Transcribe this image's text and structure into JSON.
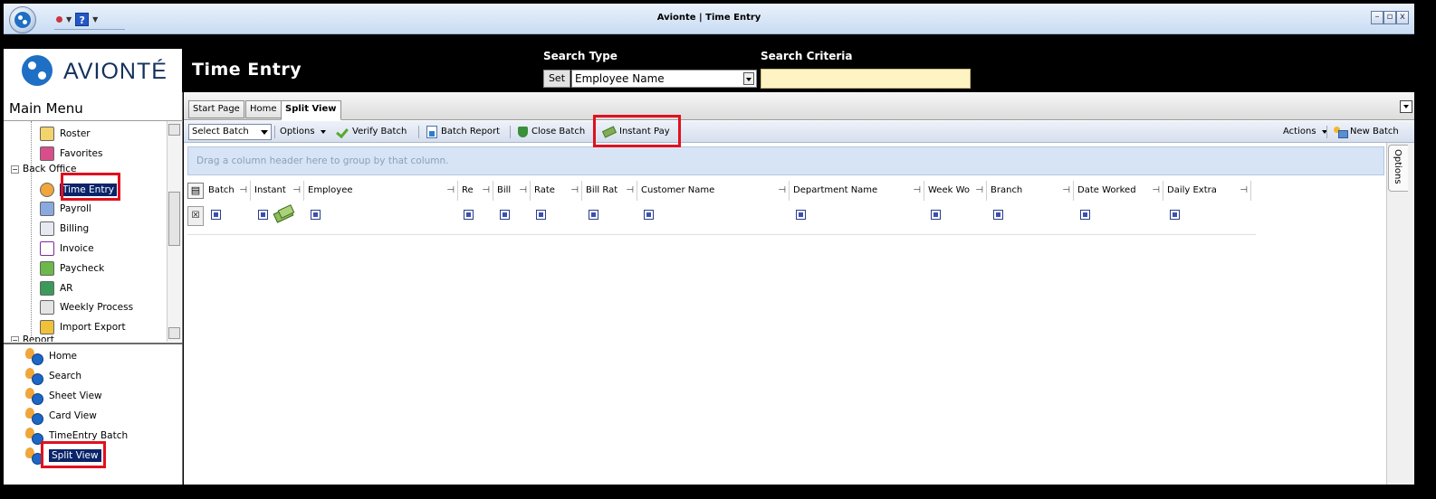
{
  "window": {
    "title": "Avionte | Time Entry"
  },
  "header": {
    "logo_text": "AVIONTÉ",
    "page_title": "Time Entry",
    "search_type_label": "Search Type",
    "search_criteria_label": "Search Criteria",
    "set_label": "Set",
    "search_type_value": "Employee Name",
    "search_criteria_value": ""
  },
  "left": {
    "main_menu_title": "Main Menu",
    "tree": {
      "roster": "Roster",
      "favorites": "Favorites",
      "back_office": "Back Office",
      "time_entry": "Time Entry",
      "payroll": "Payroll",
      "billing": "Billing",
      "invoice": "Invoice",
      "paycheck": "Paycheck",
      "ar": "AR",
      "weekly_process": "Weekly Process",
      "import_export": "Import Export",
      "report": "Report"
    },
    "nav": {
      "home": "Home",
      "search": "Search",
      "sheet_view": "Sheet View",
      "card_view": "Card View",
      "timeentry_batch": "TimeEntry Batch",
      "split_view": "Split View"
    }
  },
  "tabs": {
    "start_page": "Start Page",
    "home": "Home",
    "split_view": "Split View"
  },
  "toolbar": {
    "select_batch": "Select Batch",
    "options": "Options",
    "verify_batch": "Verify Batch",
    "batch_report": "Batch Report",
    "close_batch": "Close Batch",
    "instant_pay": "Instant Pay",
    "actions": "Actions",
    "new_batch": "New Batch"
  },
  "grid": {
    "group_hint": "Drag a column header here to group by that column.",
    "options_tab": "Options",
    "columns": {
      "batch": "Batch",
      "instant": "Instant",
      "employee": "Employee",
      "re": "Re",
      "bill": "Bill",
      "rate": "Rate",
      "bill_rat": "Bill Rat",
      "customer_name": "Customer Name",
      "department_name": "Department Name",
      "week_wo": "Week Wo",
      "branch": "Branch",
      "date_worked": "Date Worked",
      "daily_extra": "Daily Extra"
    }
  },
  "colors": {
    "highlight": "#e1101e",
    "selection": "#0a246a",
    "brand": "#1f6fc4",
    "criteria_bg": "#fdf3c3"
  }
}
